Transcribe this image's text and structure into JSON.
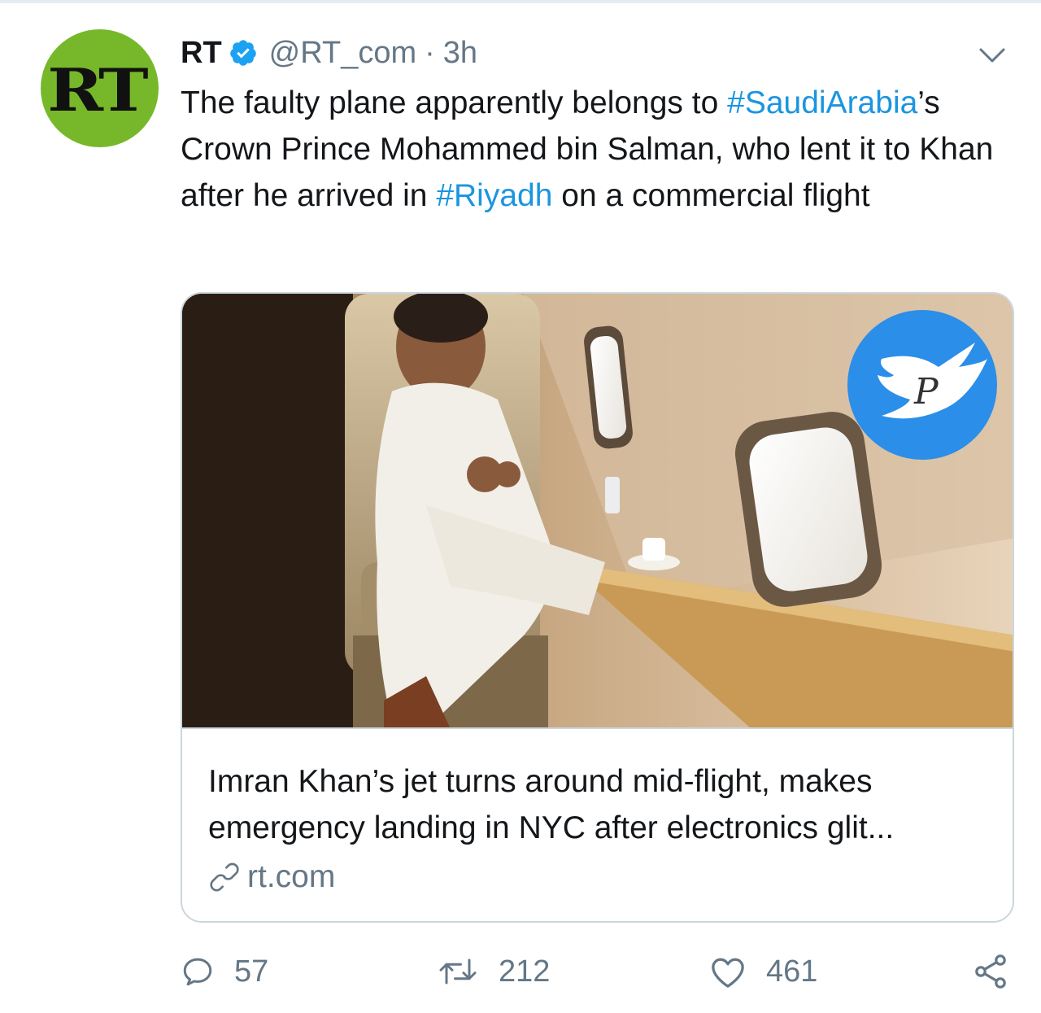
{
  "tweet": {
    "avatar_text": "RT",
    "display_name": "RT",
    "handle": "@RT_com",
    "separator": "·",
    "time": "3h",
    "text_parts": {
      "p1": "The faulty plane apparently belongs to ",
      "tag1": "#SaudiArabia",
      "p2": "’s Crown Prince Mohammed bin Salman, who lent it to Khan after he arrived in ",
      "tag2": "#Riyadh",
      "p3": " on a commercial flight"
    }
  },
  "card": {
    "title": "Imran Khan’s jet turns around mid-flight, makes emergency landing in NYC after electronics glit...",
    "domain": "rt.com"
  },
  "actions": {
    "replies": "57",
    "retweets": "212",
    "likes": "461"
  },
  "colors": {
    "accent": "#1b95e0",
    "muted": "#657786",
    "avatar_bg": "#77b82a"
  },
  "icons": [
    "verified-badge-icon",
    "chevron-down-icon",
    "link-icon",
    "reply-icon",
    "retweet-icon",
    "like-icon",
    "share-icon"
  ]
}
